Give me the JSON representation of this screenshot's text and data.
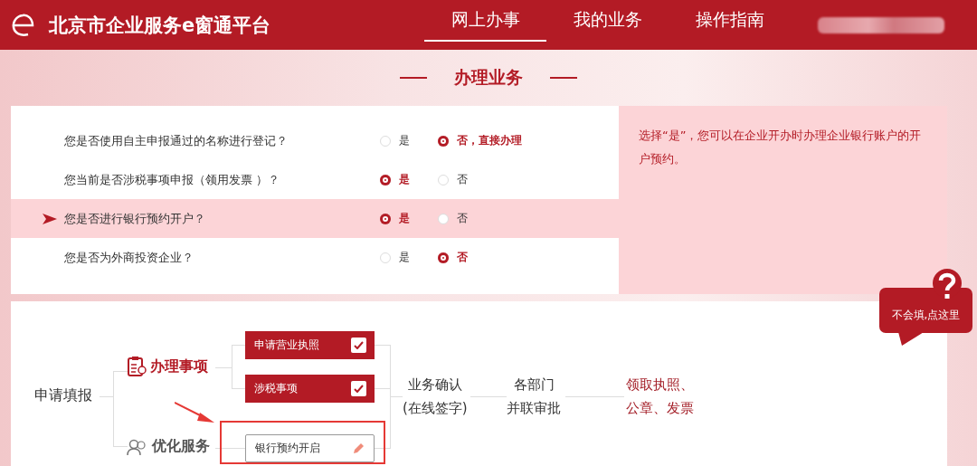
{
  "header": {
    "title": "北京市企业服务e窗通平台",
    "nav": [
      {
        "label": "网上办事",
        "selected": true
      },
      {
        "label": "我的业务",
        "selected": false
      },
      {
        "label": "操作指南",
        "selected": false
      }
    ]
  },
  "section_title": "办理业务",
  "questions": [
    {
      "text": "您是否使用自主申报通过的名称进行登记？",
      "highlighted": false,
      "options": [
        {
          "label": "是",
          "selected": false
        },
        {
          "label": "否，直接办理",
          "selected": true
        }
      ]
    },
    {
      "text": "您当前是否涉税事项申报（领用发票 ）？",
      "highlighted": false,
      "options": [
        {
          "label": "是",
          "selected": true
        },
        {
          "label": "否",
          "selected": false
        }
      ]
    },
    {
      "text": "您是否进行银行预约开户？",
      "highlighted": true,
      "options": [
        {
          "label": "是",
          "selected": true
        },
        {
          "label": "否",
          "selected": false
        }
      ]
    },
    {
      "text": "您是否为外商投资企业？",
      "highlighted": false,
      "options": [
        {
          "label": "是",
          "selected": false
        },
        {
          "label": "否",
          "selected": true
        }
      ]
    }
  ],
  "hint": "选择“是”，您可以在企业开办时办理企业银行账户的开户预约。",
  "help": {
    "label": "不会填,点这里"
  },
  "flow": {
    "start": "申请填报",
    "groups": [
      {
        "label": "办理事项",
        "kind": "tasks"
      },
      {
        "label": "优化服务",
        "kind": "services"
      }
    ],
    "items": [
      {
        "label": "申请营业执照",
        "kind": "check",
        "checked": true,
        "annotated": false
      },
      {
        "label": "涉税事项",
        "kind": "check",
        "checked": true,
        "annotated": false
      },
      {
        "label": "银行预约开启",
        "kind": "edit",
        "checked": false,
        "annotated": true
      }
    ],
    "steps": [
      {
        "lines": [
          "业务确认",
          "(在线签字)"
        ],
        "accent": false
      },
      {
        "lines": [
          "各部门",
          "并联审批"
        ],
        "accent": false
      },
      {
        "lines": [
          "领取执照、",
          "公章、发票"
        ],
        "accent": true
      }
    ]
  }
}
